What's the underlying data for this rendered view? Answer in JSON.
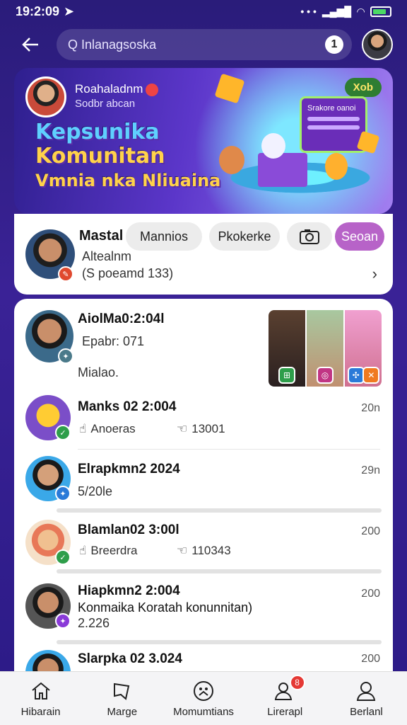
{
  "status": {
    "time": "19:2:09"
  },
  "header": {
    "search_placeholder": "Q Inlanagsoska",
    "search_badge": "1"
  },
  "banner": {
    "user_name": "Roahaladnm",
    "user_sub": "Sodbr abcan",
    "title_line1": "Kepsunika",
    "title_line2": "Komunitan",
    "title_line3": "Vmnia nka Nliuaina",
    "pill": "Xob",
    "board_label": "Srakore oanoi"
  },
  "featured": {
    "name": "Mastal",
    "sub1": "Altealnm",
    "sub2": "(S poeamd 133)",
    "chips": [
      "Mannios",
      "Pkokerke",
      "Seoan"
    ]
  },
  "rows": [
    {
      "title": "AiolMa0:2:04l",
      "sub": "Epabr: 071",
      "sub2": "Mialao."
    },
    {
      "title": "Manks 02 2:004",
      "meta1": "Anoeras",
      "meta2": "13001",
      "time": "20n"
    },
    {
      "title": "Elrapkmn2 2024",
      "sub": "5/20le",
      "time": "29n"
    },
    {
      "title": "Blamlan02 3:00l",
      "meta1": "Breerdra",
      "meta2": "110343",
      "time": "200"
    },
    {
      "title": "Hiapkmn2 2:004",
      "sub": "Konmaika Koratah konunnitan)",
      "sub2": "2.226",
      "time": "200"
    },
    {
      "title": "Slarpka 02 3.024",
      "time": "200"
    }
  ],
  "nav": [
    {
      "label": "Hibarain",
      "icon": "home-icon"
    },
    {
      "label": "Marge",
      "icon": "message-icon"
    },
    {
      "label": "Momumtians",
      "icon": "community-icon"
    },
    {
      "label": "Lirerapl",
      "icon": "people-icon",
      "badge": "8"
    },
    {
      "label": "Berlanl",
      "icon": "profile-icon"
    }
  ],
  "colors": {
    "accent": "#b763c8",
    "background": "#2a1c7a",
    "badge_red": "#e53935"
  }
}
